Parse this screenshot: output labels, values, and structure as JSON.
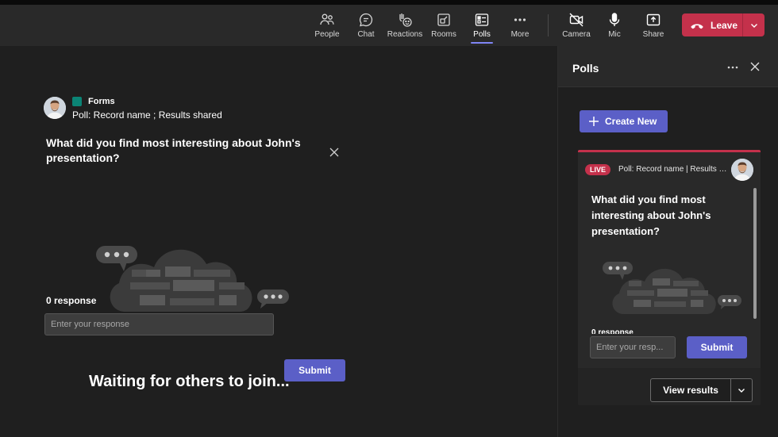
{
  "toolbar": {
    "items": [
      {
        "label": "People",
        "icon": "people-icon"
      },
      {
        "label": "Chat",
        "icon": "chat-icon"
      },
      {
        "label": "Reactions",
        "icon": "reactions-icon"
      },
      {
        "label": "Rooms",
        "icon": "rooms-icon"
      },
      {
        "label": "Polls",
        "icon": "polls-icon",
        "active": true
      },
      {
        "label": "More",
        "icon": "more-icon"
      },
      {
        "label": "Camera",
        "icon": "camera-off-icon"
      },
      {
        "label": "Mic",
        "icon": "mic-icon"
      },
      {
        "label": "Share",
        "icon": "share-icon"
      }
    ],
    "leave_label": "Leave"
  },
  "stage": {
    "app_name": "Forms",
    "poll_title": "Poll: Record name ; Results shared",
    "question": "What did you find most interesting about John's presentation?",
    "response_count": "0 response",
    "input_placeholder": "Enter your response",
    "submit_label": "Submit",
    "waiting_text": "Waiting for others to join..."
  },
  "panel": {
    "title": "Polls",
    "create_label": "Create New",
    "card": {
      "live_label": "LIVE",
      "title": "Poll: Record name | Results shared",
      "question": "What did you find most interesting about John's presentation?",
      "response_count": "0 response",
      "input_placeholder": "Enter your resp...",
      "submit_label": "Submit",
      "view_results_label": "View results"
    }
  },
  "colors": {
    "accent": "#5b5fc7",
    "leave_red": "#c4314b",
    "background": "#1f1f1f",
    "toolbar": "#292929"
  }
}
